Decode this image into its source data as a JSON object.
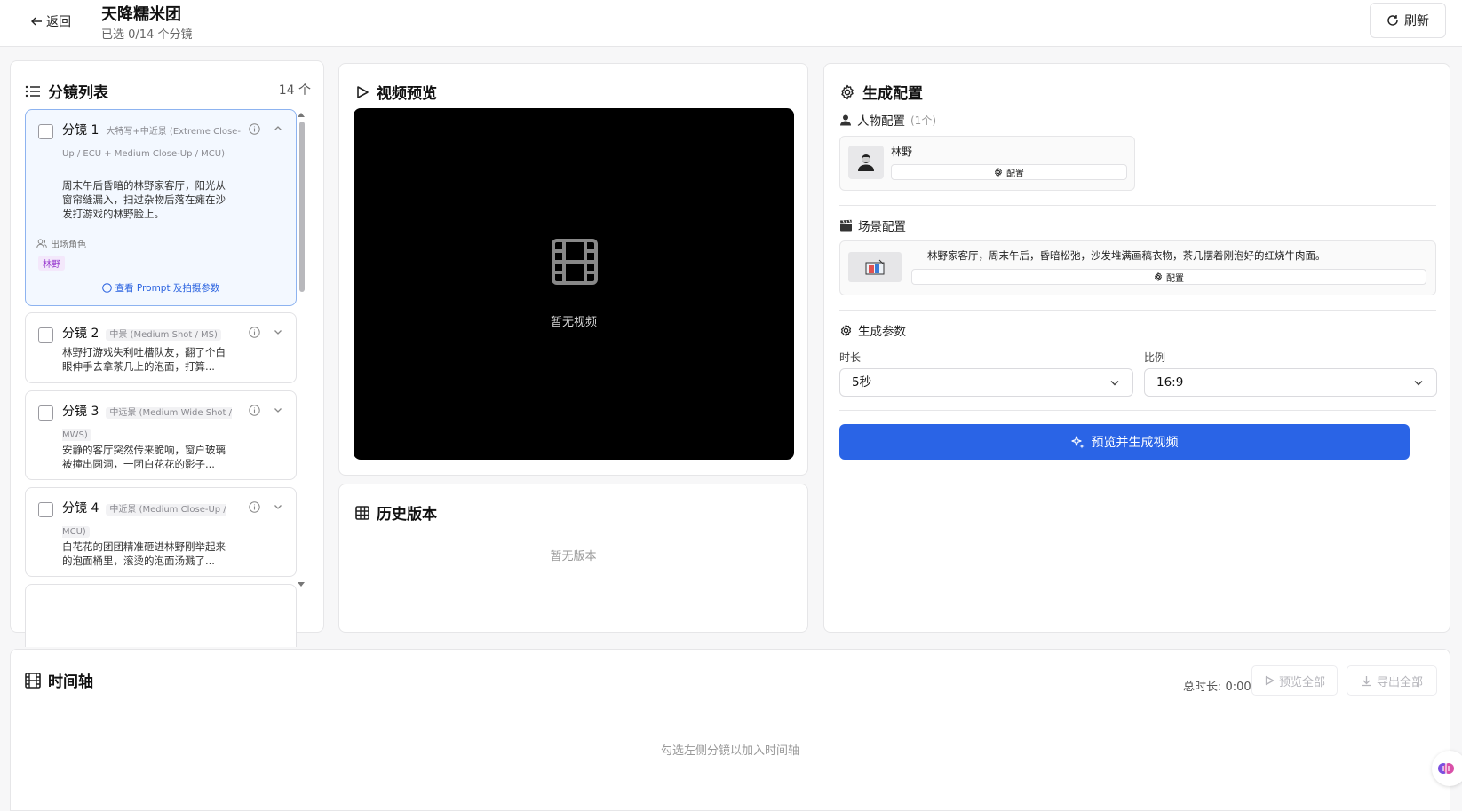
{
  "header": {
    "back_label": "返回",
    "title": "天降糯米团",
    "selection": "已选 0/14 个分镜",
    "refresh_label": "刷新"
  },
  "shot_list": {
    "title": "分镜列表",
    "count": "14 个",
    "items": [
      {
        "label": "分镜 1",
        "type": "大特写+中近景 (Extreme Close-Up / ECU + Medium Close-Up / MCU)",
        "description": "周末午后昏暗的林野家客厅，阳光从窗帘缝漏入，扫过杂物后落在瘫在沙发打游戏的林野脸上。",
        "appear_label": "出场角色",
        "characters": [
          "林野"
        ],
        "prompt_link": "查看 Prompt 及拍摄参数"
      },
      {
        "label": "分镜 2",
        "type": "中景 (Medium Shot / MS)",
        "description": "林野打游戏失利吐槽队友，翻了个白眼伸手去拿茶几上的泡面，打算..."
      },
      {
        "label": "分镜 3",
        "type": "中远景 (Medium Wide Shot / MWS)",
        "description": "安静的客厅突然传来脆响，窗户玻璃被撞出圆洞，一团白花花的影子..."
      },
      {
        "label": "分镜 4",
        "type": "中近景 (Medium Close-Up / MCU)",
        "description": "白花花的团团精准砸进林野刚举起来的泡面桶里，滚烫的泡面汤溅了..."
      }
    ]
  },
  "video_preview": {
    "title": "视频预览",
    "empty_text": "暂无视频"
  },
  "history": {
    "title": "历史版本",
    "empty_text": "暂无版本"
  },
  "generation": {
    "title": "生成配置",
    "character_section": "人物配置",
    "character_count": "(1个)",
    "character_name": "林野",
    "config_label": "配置",
    "scene_section": "场景配置",
    "scene_desc": "林野家客厅，周末午后，昏暗松弛，沙发堆满画稿衣物，茶几摆着刚泡好的红烧牛肉面。",
    "params_section": "生成参数",
    "duration_label": "时长",
    "duration_value": "5秒",
    "ratio_label": "比例",
    "ratio_value": "16:9",
    "generate_label": "预览并生成视频"
  },
  "timeline": {
    "title": "时间轴",
    "total_duration": "总时长: 0:00",
    "preview_all": "预览全部",
    "export_all": "导出全部",
    "empty_hint": "勾选左侧分镜以加入时间轴"
  },
  "colors": {
    "accent": "#2a64e6",
    "selected_card_bg": "#f3f8ff",
    "character_tag": "#9b3fd0"
  }
}
